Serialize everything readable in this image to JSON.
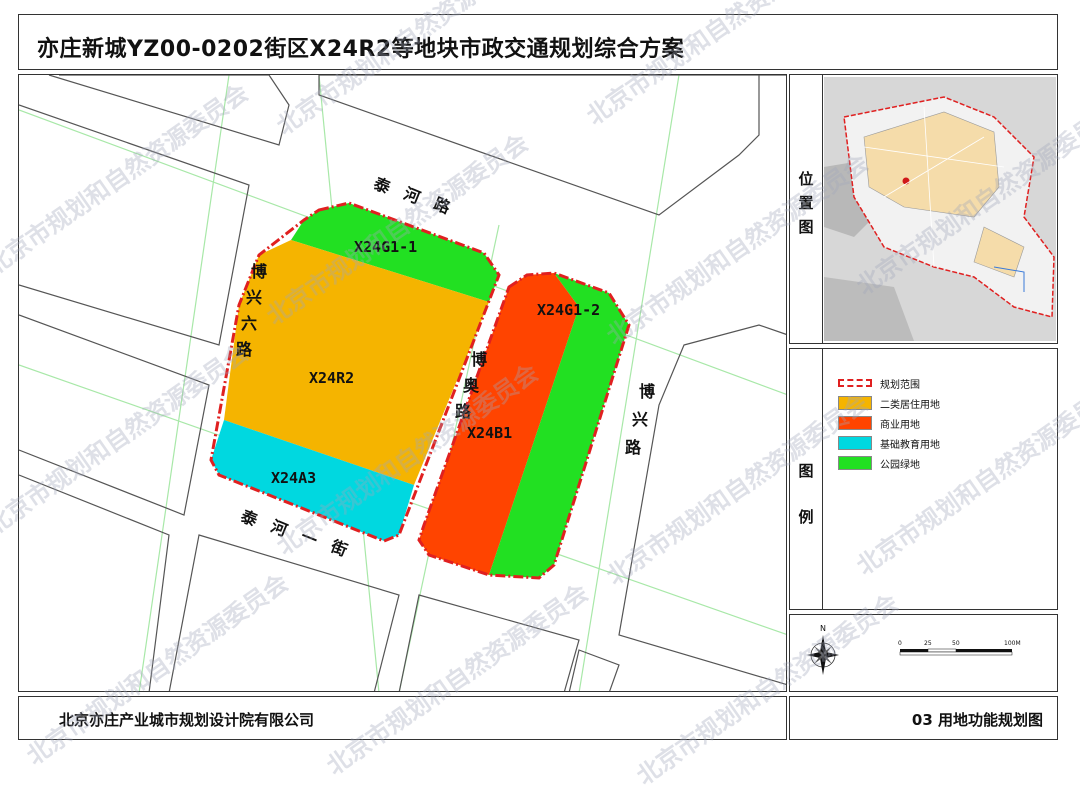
{
  "title": "亦庄新城YZ00-0202街区X24R2等地块市政交通规划综合方案",
  "parcels": {
    "g1_1": "X24G1-1",
    "r2": "X24R2",
    "a3": "X24A3",
    "g1_2": "X24G1-2",
    "b1": "X24B1"
  },
  "roads": {
    "taihe_road": [
      "泰",
      "河",
      "路"
    ],
    "taihe_1st_street": [
      "泰",
      "河",
      "一",
      "街"
    ],
    "boxing_6th_road": [
      "博",
      "兴",
      "六",
      "路"
    ],
    "boao_road": [
      "博",
      "奥",
      "路"
    ],
    "boxing_road": [
      "博",
      "兴",
      "路"
    ]
  },
  "location_map": {
    "label": [
      "位",
      "置",
      "图"
    ]
  },
  "legend": {
    "label": [
      "图",
      "例"
    ],
    "items": [
      {
        "label": "规划范围",
        "color": "#e02020"
      },
      {
        "label": "二类居住用地",
        "color": "#f5b400"
      },
      {
        "label": "商业用地",
        "color": "#ff4400"
      },
      {
        "label": "基础教育用地",
        "color": "#00d8e0"
      },
      {
        "label": "公园绿地",
        "color": "#22e022"
      }
    ]
  },
  "scale_bar": {
    "north": "N",
    "ticks": [
      "0",
      "25",
      "50",
      "100M"
    ]
  },
  "footer": {
    "company": "北京亦庄产业城市规划设计院有限公司",
    "drawing": "03 用地功能规划图"
  },
  "watermark": "北京市规划和自然资源委员会",
  "colors": {
    "road_line": "#a8e8a8",
    "block_line": "#555555",
    "boundary": "#e02020"
  }
}
